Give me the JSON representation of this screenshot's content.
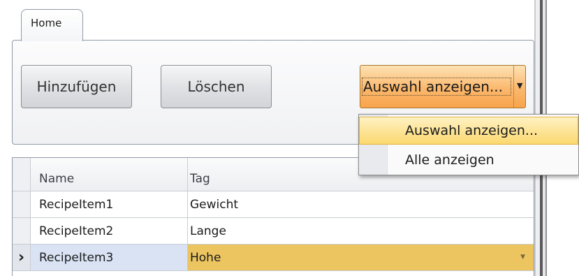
{
  "ribbon": {
    "tab_home": "Home",
    "add_label": "Hinzufügen",
    "delete_label": "Löschen",
    "filter_combo_value": "Auswahl anzeigen..."
  },
  "dropdown": {
    "items": [
      "Auswahl anzeigen...",
      "Alle anzeigen"
    ],
    "selected_index": 0
  },
  "grid": {
    "columns": [
      "Name",
      "Tag"
    ],
    "rows": [
      {
        "name": "RecipeItem1",
        "tag": "Gewicht"
      },
      {
        "name": "RecipeItem2",
        "tag": "Lange"
      },
      {
        "name": "RecipeItem3",
        "tag": "Hohe"
      }
    ],
    "selected_row": 2,
    "current_row_indicator": "›"
  },
  "icons": {
    "combo_arrow": "chevron-down-icon",
    "row_indicator": "chevron-right-icon",
    "cell_dropdown": "chevron-down-icon"
  },
  "colors": {
    "accent_orange": "#f8a44b",
    "selected_cell": "#ecc561",
    "selected_row_name": "#d9e3f4"
  }
}
